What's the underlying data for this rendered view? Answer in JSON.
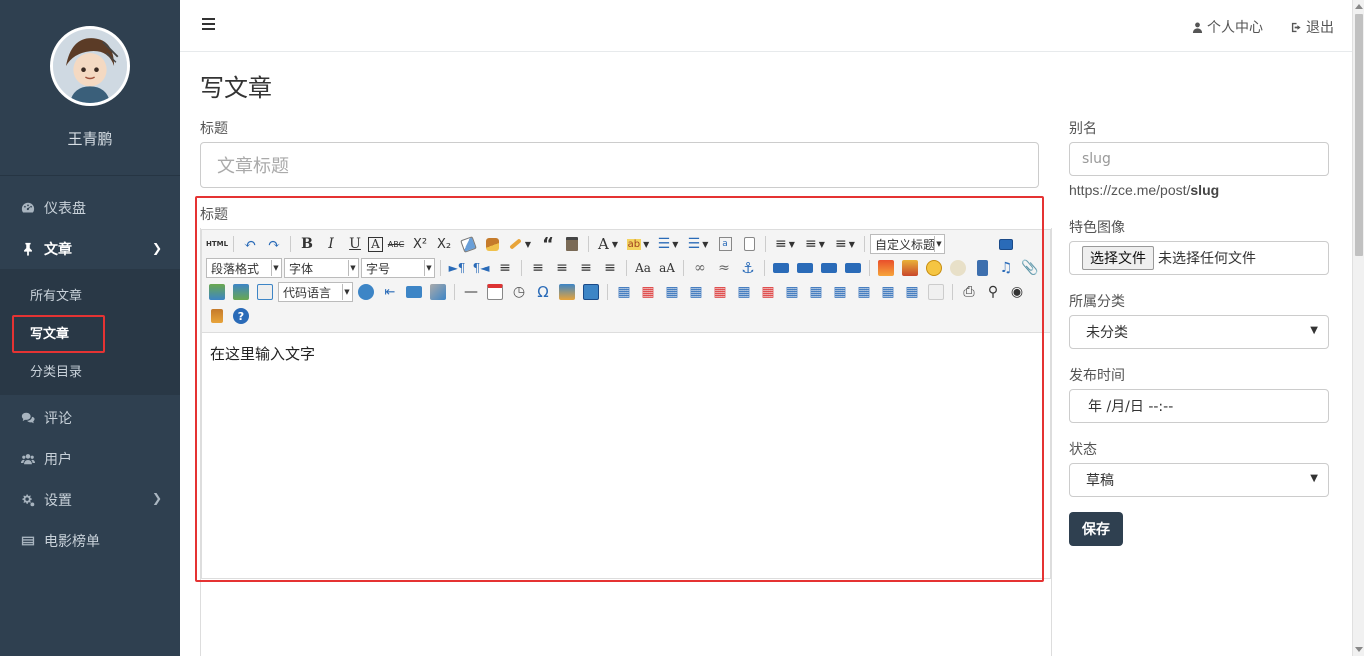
{
  "sidebar": {
    "profile_name": "王青鹏",
    "items": [
      {
        "label": "仪表盘",
        "icon": "dashboard-icon"
      },
      {
        "label": "文章",
        "icon": "pin-icon"
      },
      {
        "label": "评论",
        "icon": "comments-icon"
      },
      {
        "label": "用户",
        "icon": "users-icon"
      },
      {
        "label": "设置",
        "icon": "gears-icon"
      },
      {
        "label": "电影榜单",
        "icon": "list-icon"
      }
    ],
    "sub_items": [
      "所有文章",
      "写文章",
      "分类目录"
    ]
  },
  "header": {
    "profile_link": "个人中心",
    "logout_link": "退出"
  },
  "main": {
    "page_title": "写文章",
    "title_label": "标题",
    "title_placeholder": "文章标题",
    "content_label": "标题",
    "editor_text": "在这里输入文字",
    "toolbar": {
      "custom_title": "自定义标题",
      "paragraph": "段落格式",
      "font_family": "字体",
      "font_size": "字号",
      "code_lang": "代码语言"
    }
  },
  "side": {
    "slug_label": "别名",
    "slug_placeholder": "slug",
    "url_prefix": "https://zce.me/post/",
    "url_slug": "slug",
    "feature_label": "特色图像",
    "file_button": "选择文件",
    "file_status": "未选择任何文件",
    "category_label": "所属分类",
    "category_value": "未分类",
    "time_label": "发布时间",
    "time_value": "年 /月/日 --:--",
    "status_label": "状态",
    "status_value": "草稿",
    "save_button": "保存"
  },
  "colors": {
    "sidebar_bg": "#2f4050",
    "highlight_red": "#e53333",
    "save_bg": "#2f4050"
  }
}
